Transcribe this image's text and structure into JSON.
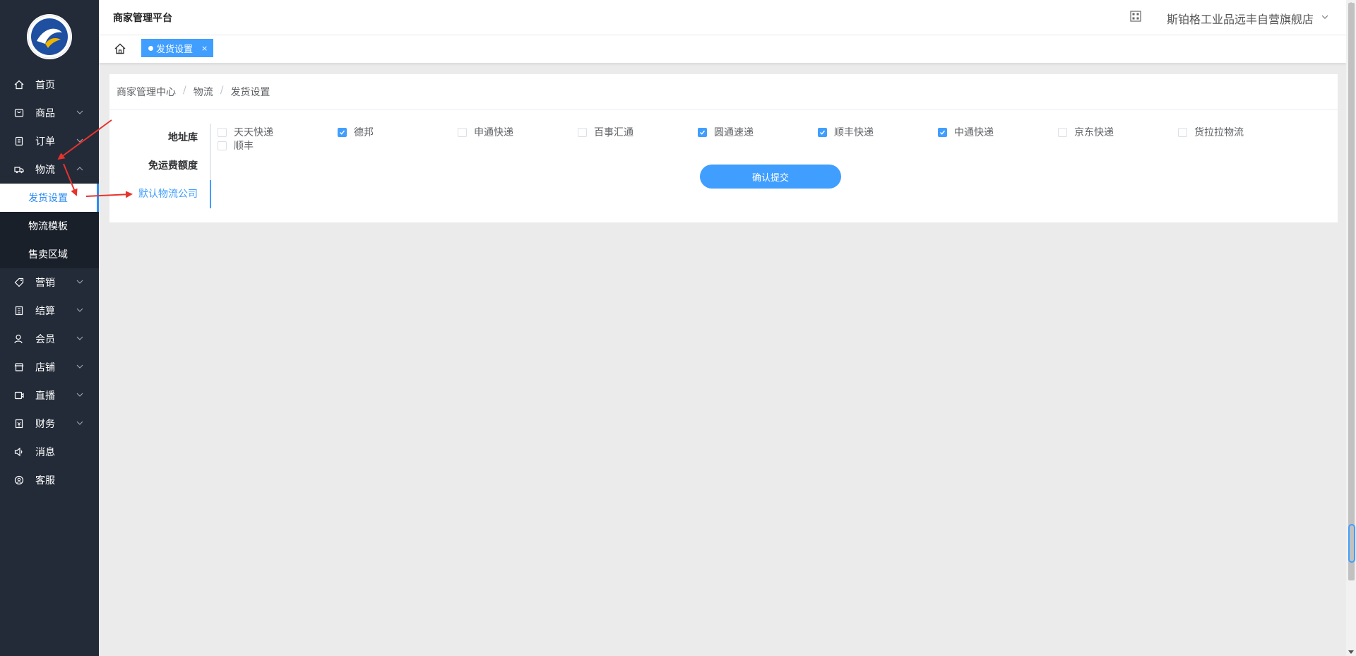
{
  "header": {
    "platform_title": "商家管理平台",
    "store_name": "斯铂格工业品远丰自营旗舰店"
  },
  "tabs": [
    {
      "label": "发货设置",
      "close": "×"
    }
  ],
  "sidebar": {
    "items": [
      {
        "label": "首页",
        "icon": "home-icon"
      },
      {
        "label": "商品",
        "icon": "goods-icon"
      },
      {
        "label": "订单",
        "icon": "order-icon"
      },
      {
        "label": "物流",
        "icon": "truck-icon"
      },
      {
        "label": "营销",
        "icon": "tag-icon"
      },
      {
        "label": "结算",
        "icon": "ledger-icon"
      },
      {
        "label": "会员",
        "icon": "user-icon"
      },
      {
        "label": "店铺",
        "icon": "shop-icon"
      },
      {
        "label": "直播",
        "icon": "live-icon"
      },
      {
        "label": "财务",
        "icon": "finance-icon"
      },
      {
        "label": "消息",
        "icon": "speaker-icon"
      },
      {
        "label": "客服",
        "icon": "service-icon"
      }
    ],
    "logistics_sub": [
      {
        "label": "发货设置"
      },
      {
        "label": "物流模板"
      },
      {
        "label": "售卖区域"
      }
    ]
  },
  "breadcrumb": [
    "商家管理中心",
    "物流",
    "发货设置"
  ],
  "settings_tabs": [
    {
      "label": "地址库"
    },
    {
      "label": "免运费额度"
    },
    {
      "label": "默认物流公司"
    }
  ],
  "companies": [
    {
      "label": "天天快递",
      "checked": false
    },
    {
      "label": "德邦",
      "checked": true
    },
    {
      "label": "申通快递",
      "checked": false
    },
    {
      "label": "百事汇通",
      "checked": false
    },
    {
      "label": "圆通速递",
      "checked": true
    },
    {
      "label": "顺丰快递",
      "checked": true
    },
    {
      "label": "中通快递",
      "checked": true
    },
    {
      "label": "京东快递",
      "checked": false
    },
    {
      "label": "货拉拉物流",
      "checked": false
    },
    {
      "label": "顺丰",
      "checked": false
    }
  ],
  "submit_label": "确认提交",
  "colors": {
    "sidebar": "#232b38",
    "accent": "#409eff",
    "arrow": "#e8322c"
  }
}
